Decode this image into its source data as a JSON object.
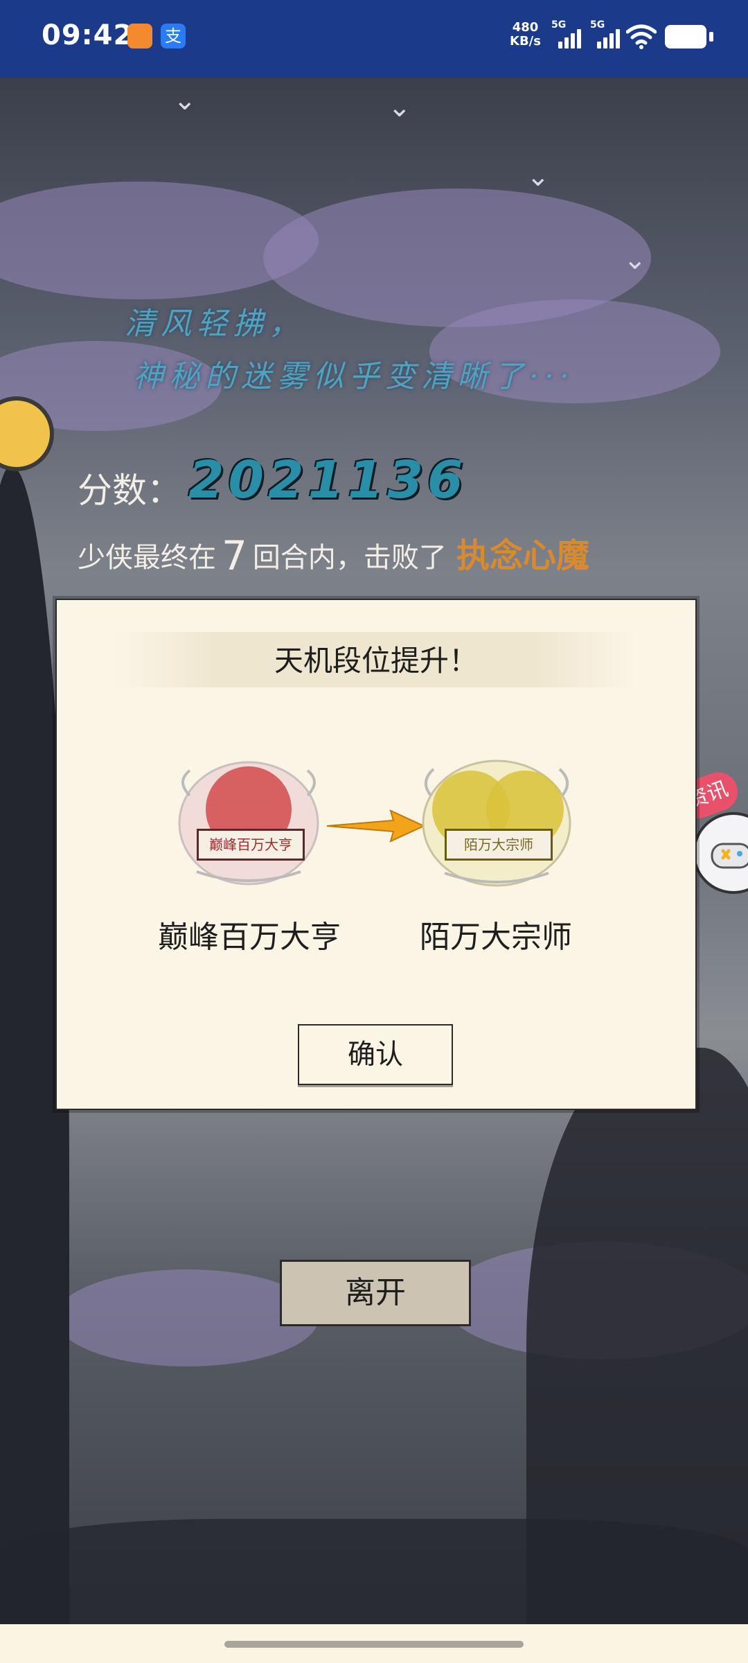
{
  "status_bar": {
    "time": "09:42",
    "net_speed_value": "480",
    "net_speed_unit": "KB/s",
    "signal1_label": "5G",
    "signal2_label": "5G",
    "app_icons": [
      "video-app-icon",
      "alipay-icon"
    ],
    "alipay_glyph": "支"
  },
  "scene": {
    "poem_line1": "清风轻拂，",
    "poem_line2": "神秘的迷雾似乎变清晰了···",
    "score_label": "分数：",
    "score_value": "2021136",
    "result_prefix": "少侠最终在",
    "result_rounds": "7",
    "result_middle": "回合内，击败了",
    "result_boss": "执念心魔",
    "news_tag": "资讯"
  },
  "modal": {
    "title": "天机段位提升！",
    "old_rank_plate": "巅峰百万大亨",
    "new_rank_plate": "陌万大宗师",
    "old_rank_name": "巅峰百万大亨",
    "new_rank_name": "陌万大宗师",
    "confirm_label": "确认"
  },
  "leave_label": "离开",
  "colors": {
    "status_bar": "#1c3a8a",
    "modal_bg": "#fbf5e6",
    "score": "#2a8ea8",
    "boss": "#d98a2e",
    "old_rank_seal": "#d24a4a",
    "new_rank_seal": "#d9c23a",
    "arrow": "#f2a51a"
  }
}
